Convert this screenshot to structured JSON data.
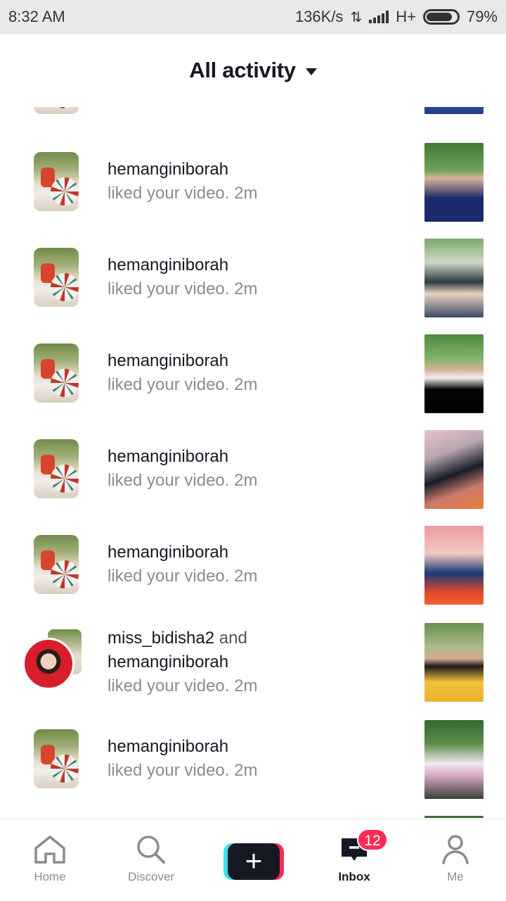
{
  "status_bar": {
    "time": "8:32 AM",
    "speed": "136K/s",
    "network": "H+",
    "battery": "79%"
  },
  "header": {
    "title": "All activity"
  },
  "rows": [
    {
      "username": "hemanginiborah",
      "action": "liked your video.",
      "time": "2m"
    },
    {
      "username": "hemanginiborah",
      "action": "liked your video.",
      "time": "2m"
    },
    {
      "username": "hemanginiborah",
      "action": "liked your video.",
      "time": "2m"
    },
    {
      "username": "hemanginiborah",
      "action": "liked your video.",
      "time": "2m"
    },
    {
      "username": "hemanginiborah",
      "action": "liked your video.",
      "time": "2m"
    },
    {
      "username": "miss_bidisha2",
      "connector": "and",
      "username2": "hemanginiborah",
      "action": "liked your video.",
      "time": "2m"
    },
    {
      "username": "hemanginiborah",
      "action": "liked your video.",
      "time": "2m"
    }
  ],
  "bottom_nav": {
    "home": "Home",
    "discover": "Discover",
    "create": "+",
    "inbox": "Inbox",
    "inbox_badge": "12",
    "me": "Me"
  }
}
